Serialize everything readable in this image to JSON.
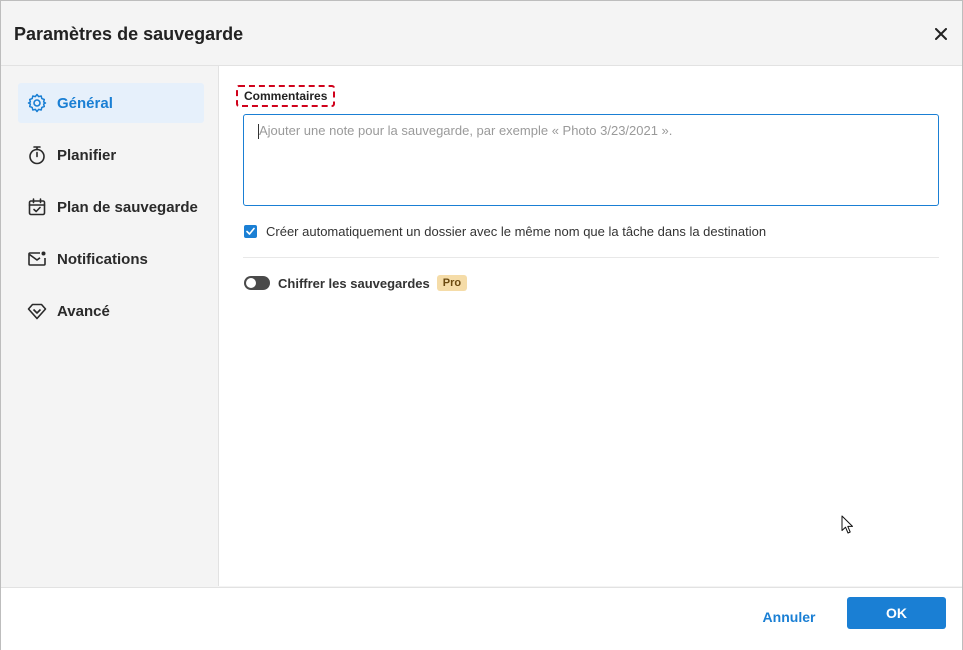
{
  "dialog": {
    "title": "Paramètres de sauvegarde"
  },
  "sidebar": {
    "items": [
      {
        "label": "Général",
        "icon": "gear-icon",
        "active": true
      },
      {
        "label": "Planifier",
        "icon": "stopwatch-icon",
        "active": false
      },
      {
        "label": "Plan de sauvegarde",
        "icon": "calendar-check-icon",
        "active": false
      },
      {
        "label": "Notifications",
        "icon": "mail-icon",
        "active": false
      },
      {
        "label": "Avancé",
        "icon": "diamond-icon",
        "active": false
      }
    ]
  },
  "main": {
    "comments_label": "Commentaires",
    "comments_placeholder": "Ajouter une note pour la sauvegarde, par exemple « Photo 3/23/2021 ».",
    "comments_value": "",
    "auto_folder": {
      "label": "Créer automatiquement un dossier avec le même nom que la tâche dans la destination",
      "checked": true
    },
    "encrypt": {
      "label": "Chiffrer les sauvegardes",
      "enabled": false,
      "badge": "Pro"
    }
  },
  "footer": {
    "cancel_label": "Annuler",
    "ok_label": "OK"
  },
  "colors": {
    "accent": "#1a7fd4",
    "active_bg": "#e6f0fb",
    "highlight": "#d0021b",
    "pro_badge": "#f5dca8"
  }
}
